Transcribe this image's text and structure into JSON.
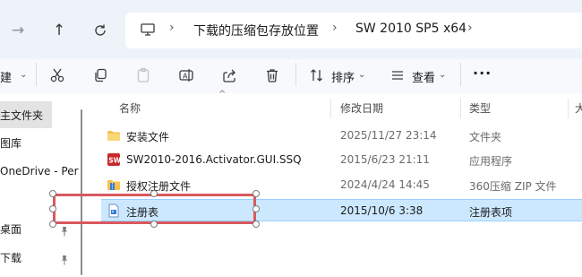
{
  "address": {
    "breadcrumbs": [
      "下载的压缩包存放位置",
      "SW 2010 SP5 x64"
    ]
  },
  "toolbar": {
    "new_partial": "建",
    "sort_label": "排序",
    "view_label": "查看",
    "more_label": "···"
  },
  "sidebar": {
    "items": [
      {
        "label": "主文件夹",
        "selected": true
      },
      {
        "label": "图库"
      },
      {
        "label": "OneDrive - Per"
      },
      {
        "label": "桌面",
        "pinned": true
      },
      {
        "label": "下载",
        "pinned": true
      }
    ]
  },
  "columns": {
    "name": "名称",
    "modified": "修改日期",
    "type": "类型",
    "size_partial": "大"
  },
  "files": [
    {
      "name": "安装文件",
      "date": "2025/11/27 23:14",
      "type": "文件夹",
      "icon": "folder-icon"
    },
    {
      "name": "SW2010-2016.Activator.GUI.SSQ",
      "date": "2015/6/23 21:11",
      "type": "应用程序",
      "icon": "exe-icon"
    },
    {
      "name": "授权注册文件",
      "date": "2024/4/24 14:45",
      "type": "360压缩 ZIP 文件",
      "icon": "zip-icon"
    },
    {
      "name": "注册表",
      "date": "2015/10/6 3:38",
      "type": "注册表项",
      "icon": "reg-icon",
      "selected": true
    }
  ],
  "colors": {
    "selection": "#cce8ff",
    "highlight_box": "#d9595f",
    "folder": "#f4c24d"
  }
}
